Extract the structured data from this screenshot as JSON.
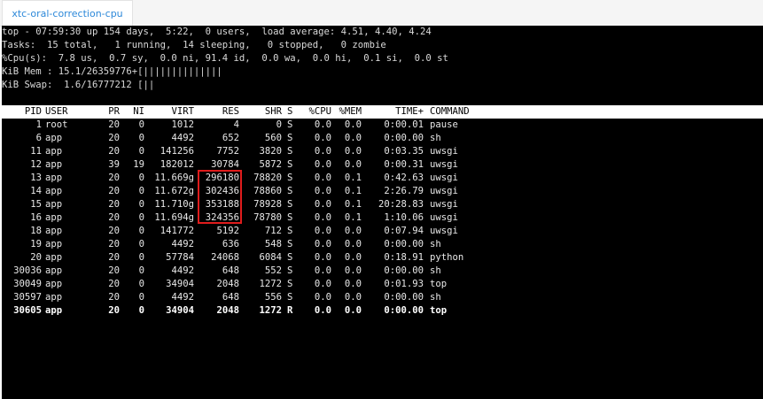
{
  "tab": {
    "label": "xtc-oral-correction-cpu"
  },
  "summary": [
    "top - 07:59:30 up 154 days,  5:22,  0 users,  load average: 4.51, 4.40, 4.24",
    "Tasks:  15 total,   1 running,  14 sleeping,   0 stopped,   0 zombie",
    "%Cpu(s):  7.8 us,  0.7 sy,  0.0 ni, 91.4 id,  0.0 wa,  0.0 hi,  0.1 si,  0.0 st",
    "KiB Mem : 15.1/26359776+[||||||||||||||",
    "KiB Swap:  1.6/16777212 [||"
  ],
  "columns": [
    "PID",
    "USER",
    "PR",
    "NI",
    "VIRT",
    "RES",
    "SHR",
    "S",
    "%CPU",
    "%MEM",
    "TIME+",
    "COMMAND"
  ],
  "processes": [
    {
      "pid": "1",
      "user": "root",
      "pr": "20",
      "ni": "0",
      "virt": "1012",
      "res": "4",
      "shr": "0",
      "s": "S",
      "cpu": "0.0",
      "mem": "0.0",
      "time": "0:00.01",
      "cmd": "pause"
    },
    {
      "pid": "6",
      "user": "app",
      "pr": "20",
      "ni": "0",
      "virt": "4492",
      "res": "652",
      "shr": "560",
      "s": "S",
      "cpu": "0.0",
      "mem": "0.0",
      "time": "0:00.00",
      "cmd": "sh"
    },
    {
      "pid": "11",
      "user": "app",
      "pr": "20",
      "ni": "0",
      "virt": "141256",
      "res": "7752",
      "shr": "3820",
      "s": "S",
      "cpu": "0.0",
      "mem": "0.0",
      "time": "0:03.35",
      "cmd": "uwsgi"
    },
    {
      "pid": "12",
      "user": "app",
      "pr": "39",
      "ni": "19",
      "virt": "182012",
      "res": "30784",
      "shr": "5872",
      "s": "S",
      "cpu": "0.0",
      "mem": "0.0",
      "time": "0:00.31",
      "cmd": "uwsgi"
    },
    {
      "pid": "13",
      "user": "app",
      "pr": "20",
      "ni": "0",
      "virt": "11.669g",
      "res": "296180",
      "shr": "78820",
      "s": "S",
      "cpu": "0.0",
      "mem": "0.1",
      "time": "0:42.63",
      "cmd": "uwsgi"
    },
    {
      "pid": "14",
      "user": "app",
      "pr": "20",
      "ni": "0",
      "virt": "11.672g",
      "res": "302436",
      "shr": "78860",
      "s": "S",
      "cpu": "0.0",
      "mem": "0.1",
      "time": "2:26.79",
      "cmd": "uwsgi"
    },
    {
      "pid": "15",
      "user": "app",
      "pr": "20",
      "ni": "0",
      "virt": "11.710g",
      "res": "353188",
      "shr": "78928",
      "s": "S",
      "cpu": "0.0",
      "mem": "0.1",
      "time": "20:28.83",
      "cmd": "uwsgi"
    },
    {
      "pid": "16",
      "user": "app",
      "pr": "20",
      "ni": "0",
      "virt": "11.694g",
      "res": "324356",
      "shr": "78780",
      "s": "S",
      "cpu": "0.0",
      "mem": "0.1",
      "time": "1:10.06",
      "cmd": "uwsgi"
    },
    {
      "pid": "18",
      "user": "app",
      "pr": "20",
      "ni": "0",
      "virt": "141772",
      "res": "5192",
      "shr": "712",
      "s": "S",
      "cpu": "0.0",
      "mem": "0.0",
      "time": "0:07.94",
      "cmd": "uwsgi"
    },
    {
      "pid": "19",
      "user": "app",
      "pr": "20",
      "ni": "0",
      "virt": "4492",
      "res": "636",
      "shr": "548",
      "s": "S",
      "cpu": "0.0",
      "mem": "0.0",
      "time": "0:00.00",
      "cmd": "sh"
    },
    {
      "pid": "20",
      "user": "app",
      "pr": "20",
      "ni": "0",
      "virt": "57784",
      "res": "24068",
      "shr": "6084",
      "s": "S",
      "cpu": "0.0",
      "mem": "0.0",
      "time": "0:18.91",
      "cmd": "python"
    },
    {
      "pid": "30036",
      "user": "app",
      "pr": "20",
      "ni": "0",
      "virt": "4492",
      "res": "648",
      "shr": "552",
      "s": "S",
      "cpu": "0.0",
      "mem": "0.0",
      "time": "0:00.00",
      "cmd": "sh"
    },
    {
      "pid": "30049",
      "user": "app",
      "pr": "20",
      "ni": "0",
      "virt": "34904",
      "res": "2048",
      "shr": "1272",
      "s": "S",
      "cpu": "0.0",
      "mem": "0.0",
      "time": "0:01.93",
      "cmd": "top"
    },
    {
      "pid": "30597",
      "user": "app",
      "pr": "20",
      "ni": "0",
      "virt": "4492",
      "res": "648",
      "shr": "556",
      "s": "S",
      "cpu": "0.0",
      "mem": "0.0",
      "time": "0:00.00",
      "cmd": "sh"
    },
    {
      "pid": "30605",
      "user": "app",
      "pr": "20",
      "ni": "0",
      "virt": "34904",
      "res": "2048",
      "shr": "1272",
      "s": "R",
      "cpu": "0.0",
      "mem": "0.0",
      "time": "0:00.00",
      "cmd": "top",
      "bold": true
    }
  ],
  "highlight": {
    "color": "#e01c1c",
    "column": "RES",
    "rows": [
      "13",
      "14",
      "15",
      "16"
    ]
  },
  "colors": {
    "terminal_bg": "#000000",
    "terminal_fg": "#e8e8e8",
    "tab_text": "#2c88d9"
  }
}
